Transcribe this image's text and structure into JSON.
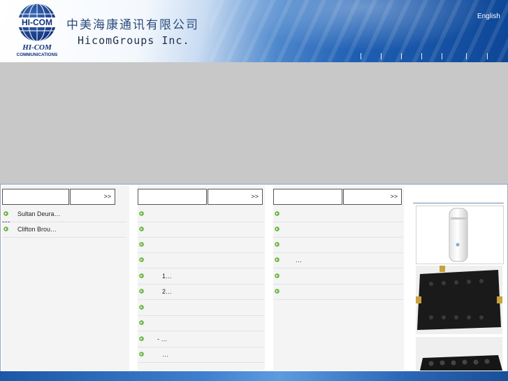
{
  "header": {
    "logo_text": "HI-COM",
    "logo_sub1": "HI-COM",
    "logo_sub2": "COMMUNICATIONS",
    "title_cn": "中美海康通讯有限公司",
    "title_en": "HicomGroups Inc.",
    "lang_link": "English",
    "nav_separators": 7
  },
  "columns": [
    {
      "more": ">>",
      "items": [
        {
          "text": "Sultan Deura…",
          "indent": "short"
        },
        {
          "text": "Clifton Brou…",
          "indent": "short"
        }
      ]
    },
    {
      "more": ">>",
      "items": [
        {
          "text": ""
        },
        {
          "text": ""
        },
        {
          "text": ""
        },
        {
          "text": ""
        },
        {
          "text": "1…"
        },
        {
          "text": "2…"
        },
        {
          "text": ""
        },
        {
          "text": ""
        },
        {
          "text": "- …"
        },
        {
          "text": "…"
        }
      ]
    },
    {
      "more": ">>",
      "items": [
        {
          "text": ""
        },
        {
          "text": ""
        },
        {
          "text": ""
        },
        {
          "text": "…"
        },
        {
          "text": ""
        },
        {
          "text": ""
        }
      ]
    }
  ],
  "colors": {
    "banner": "#c8c8c8",
    "column_bg": "#f4f4f4",
    "bullet": "#6db33f",
    "header_blue": "#1f5fb3"
  }
}
